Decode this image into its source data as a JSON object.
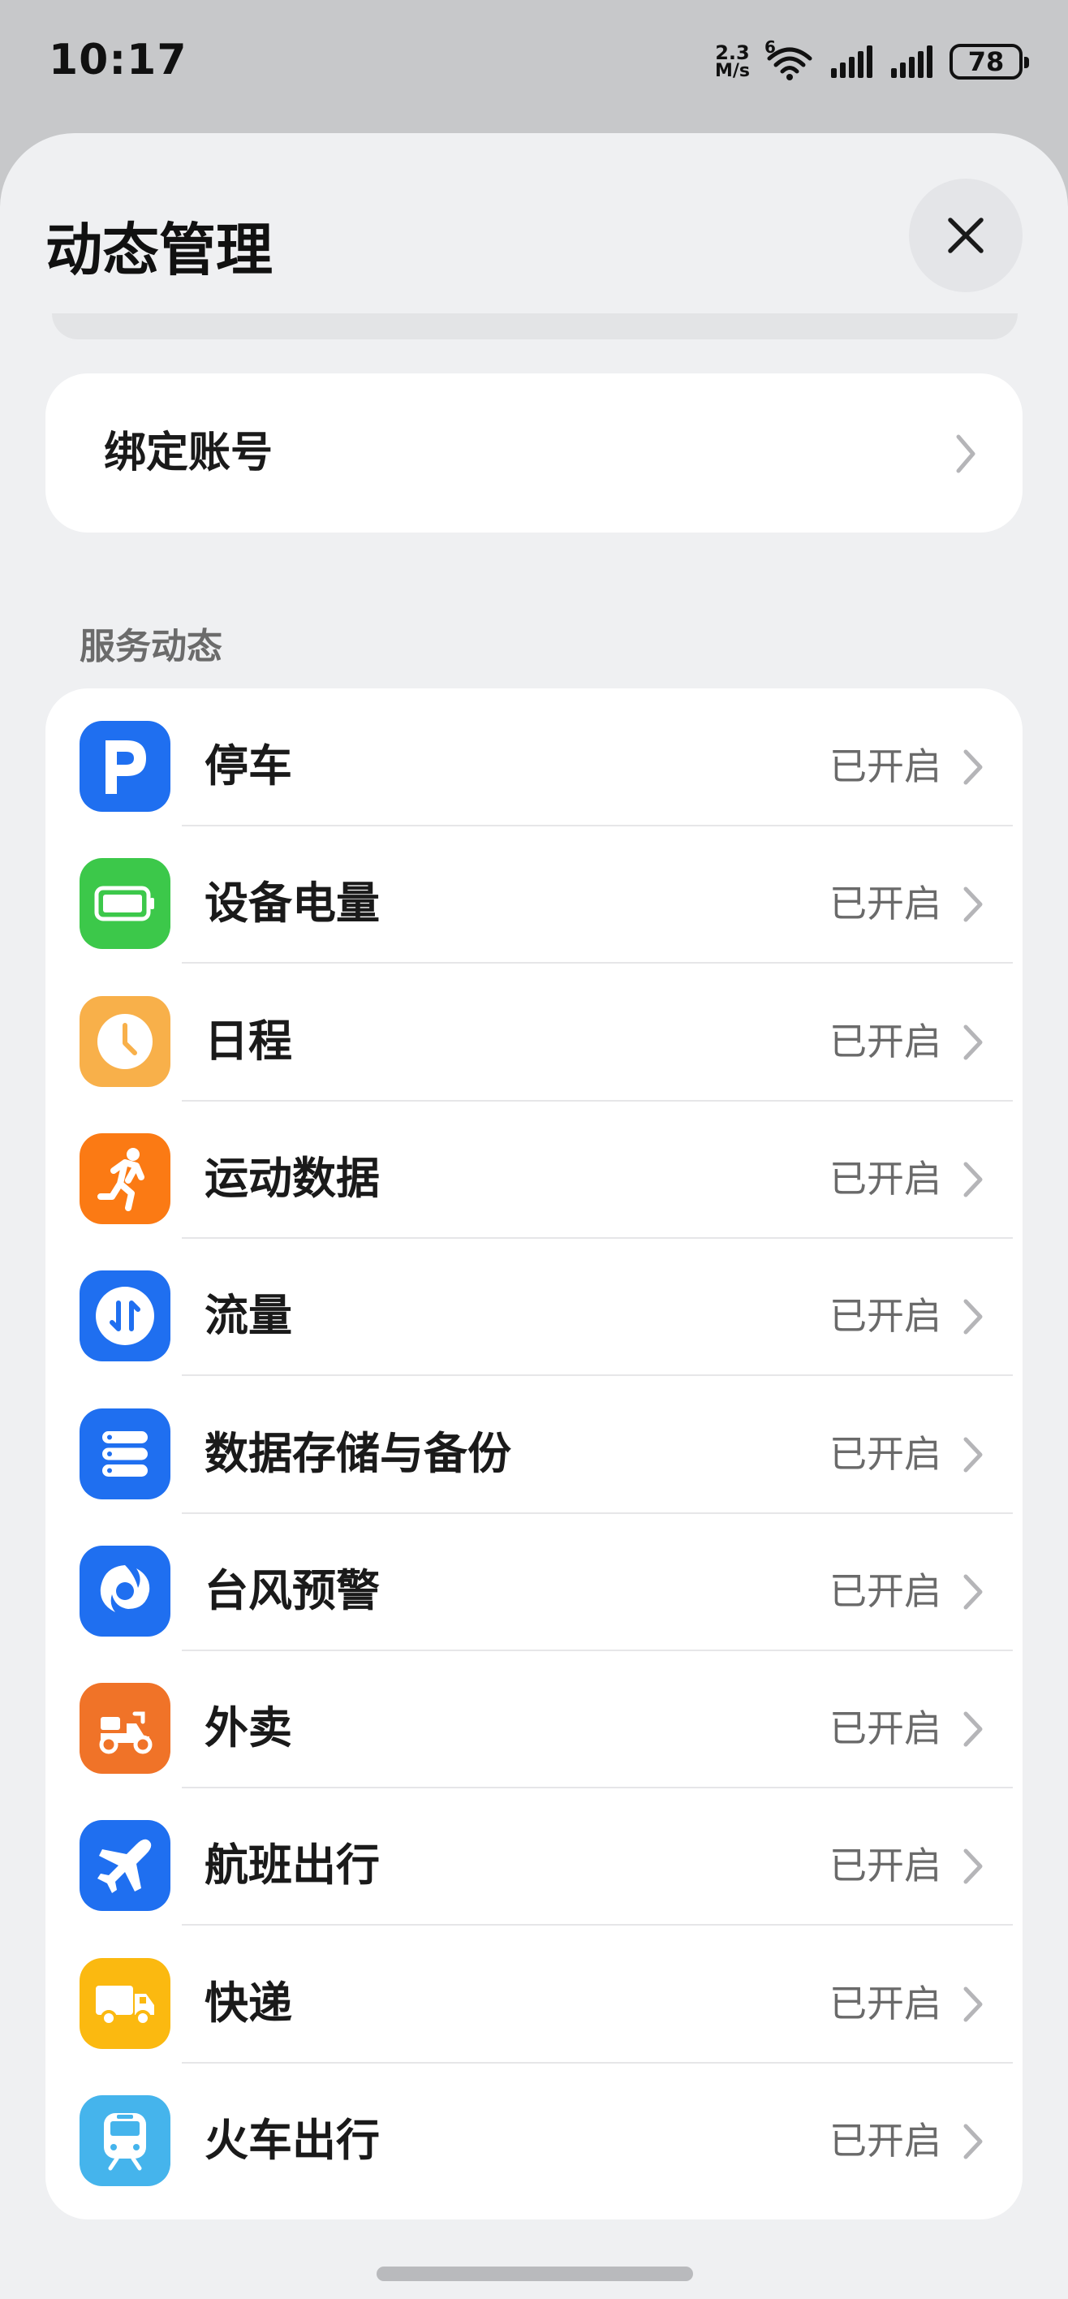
{
  "status_bar": {
    "time": "10:17",
    "net_speed_value": "2.3",
    "net_speed_unit": "M/s",
    "wifi_badge": "6",
    "battery": "78"
  },
  "sheet": {
    "title": "动态管理",
    "bind_account_label": "绑定账号",
    "section_label": "服务动态"
  },
  "services": [
    {
      "label": "停车",
      "status": "已开启",
      "icon": "parking-icon",
      "color": "#1f6ff0"
    },
    {
      "label": "设备电量",
      "status": "已开启",
      "icon": "battery-icon",
      "color": "#3cc84a"
    },
    {
      "label": "日程",
      "status": "已开启",
      "icon": "clock-icon",
      "color": "#f8b04a"
    },
    {
      "label": "运动数据",
      "status": "已开启",
      "icon": "running-icon",
      "color": "#fb7a14"
    },
    {
      "label": "流量",
      "status": "已开启",
      "icon": "data-traffic-icon",
      "color": "#1f6ff0"
    },
    {
      "label": "数据存储与备份",
      "status": "已开启",
      "icon": "storage-icon",
      "color": "#1f6ff0"
    },
    {
      "label": "台风预警",
      "status": "已开启",
      "icon": "typhoon-icon",
      "color": "#1f6ff0"
    },
    {
      "label": "外卖",
      "status": "已开启",
      "icon": "scooter-icon",
      "color": "#f07328"
    },
    {
      "label": "航班出行",
      "status": "已开启",
      "icon": "airplane-icon",
      "color": "#1f6ff0"
    },
    {
      "label": "快递",
      "status": "已开启",
      "icon": "delivery-truck-icon",
      "color": "#fbb910"
    },
    {
      "label": "火车出行",
      "status": "已开启",
      "icon": "train-icon",
      "color": "#45b4ec"
    }
  ]
}
